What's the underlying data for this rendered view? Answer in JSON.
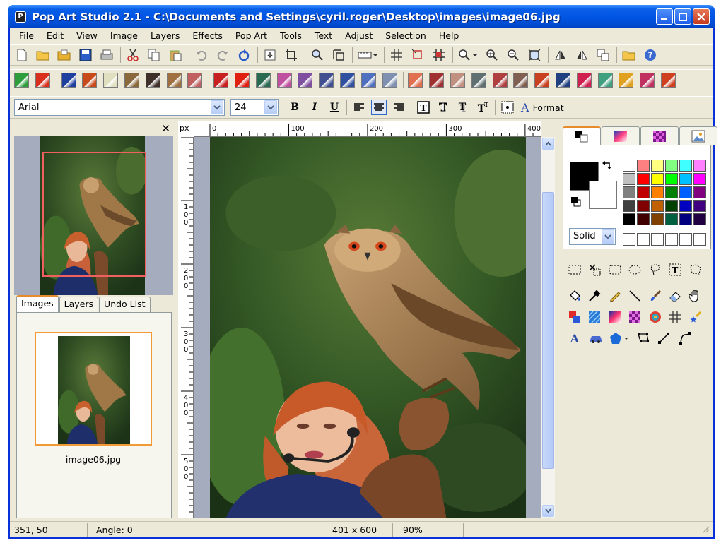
{
  "window": {
    "title": "Pop Art Studio 2.1 - C:\\Documents and Settings\\cyril.roger\\Desktop\\images\\image06.jpg",
    "app_icon_glyph": "P"
  },
  "menu": [
    "File",
    "Edit",
    "View",
    "Image",
    "Layers",
    "Effects",
    "Pop Art",
    "Tools",
    "Text",
    "Adjust",
    "Selection",
    "Help"
  ],
  "toolbar_icons": [
    "new-document-icon",
    "open-folder-icon",
    "open-recent-icon",
    "save-icon",
    "print-icon",
    "cut-icon",
    "copy-icon",
    "paste-icon",
    "undo-icon",
    "redo-icon",
    "refresh-icon",
    "import-icon",
    "crop-icon",
    "zoom-tool-icon",
    "resize-icon",
    "ruler-dropdown-icon",
    "grid-icon",
    "rotate-icon",
    "flip-icon",
    "zoom-dropdown-icon",
    "zoom-in-icon",
    "zoom-out-icon",
    "fit-window-icon",
    "mirror-horizontal-icon",
    "mirror-vertical-icon",
    "duplicate-icon",
    "open-browser-icon",
    "help-icon"
  ],
  "effects": {
    "colors": [
      "#2e9e3c",
      "#d8301c",
      "#2040a0",
      "#c84a1a",
      "#e0e0c0",
      "#8a6a3c",
      "#40302a",
      "#a07040",
      "#c06060",
      "#c82020",
      "#e02010",
      "#2a6a50",
      "#c050a0",
      "#8050a0",
      "#405090",
      "#3050a0",
      "#5070c0",
      "#8090b0",
      "#e07050",
      "#a03030",
      "#c09080",
      "#607070",
      "#b04040",
      "#806050",
      "#c84020",
      "#204080",
      "#d02050",
      "#40a080",
      "#e0a020",
      "#c03060",
      "#d04020"
    ]
  },
  "format": {
    "font": "Arial",
    "size": "24",
    "bold": "B",
    "italic": "I",
    "underline": "U",
    "format_label": "Format",
    "format_glyph": "A"
  },
  "navigator": {
    "close_glyph": "✕"
  },
  "tabs": [
    {
      "label": "Images",
      "active": true
    },
    {
      "label": "Layers",
      "active": false
    },
    {
      "label": "Undo List",
      "active": false
    }
  ],
  "images_list": {
    "caption": "image06.jpg"
  },
  "ruler": {
    "unit": "px",
    "h_labels": [
      "0",
      "100",
      "200",
      "300",
      "400"
    ],
    "v_labels": [
      "1 0 0",
      "2 0 0",
      "3 0 0",
      "4 0 0",
      "5 0 0"
    ]
  },
  "colors": {
    "foreground": "#000000",
    "background": "#ffffff",
    "palette": [
      "#ffffff",
      "#ff8080",
      "#ffff80",
      "#80ff80",
      "#40ffff",
      "#ff80ff",
      "#c0c0c0",
      "#ff0000",
      "#ffff00",
      "#00ff00",
      "#00c0ff",
      "#ff00ff",
      "#808080",
      "#c00000",
      "#ff8000",
      "#008000",
      "#0060ff",
      "#800080",
      "#404040",
      "#800000",
      "#c06000",
      "#004000",
      "#0000c0",
      "#400080",
      "#000000",
      "#400000",
      "#804000",
      "#006040",
      "#000080",
      "#200040"
    ],
    "fill_style": "Solid"
  },
  "tools": {
    "row1": [
      "rect-select-icon",
      "magic-select-icon",
      "rounded-select-icon",
      "ellipse-select-icon",
      "lasso-select-icon",
      "text-select-icon",
      "polygon-select-icon"
    ],
    "row2": [
      "fill-bucket-icon",
      "eyedropper-icon",
      "pencil-icon",
      "line-icon",
      "brush-icon",
      "eraser-icon",
      "hand-icon"
    ],
    "row3": [
      "color-replace-icon",
      "pattern-fill-icon",
      "gradient-icon",
      "checker-icon",
      "radial-icon",
      "grid-tool-icon",
      "sparkle-brush-icon"
    ],
    "row4": [
      "text-tool-icon",
      "car-stamp-icon",
      "shape-icon",
      "polygon-icon",
      "line-tool-icon",
      "curve-icon"
    ]
  },
  "status": {
    "coords": "351, 50",
    "angle": "Angle: 0",
    "dimensions": "401 x 600",
    "zoom": "90%"
  }
}
